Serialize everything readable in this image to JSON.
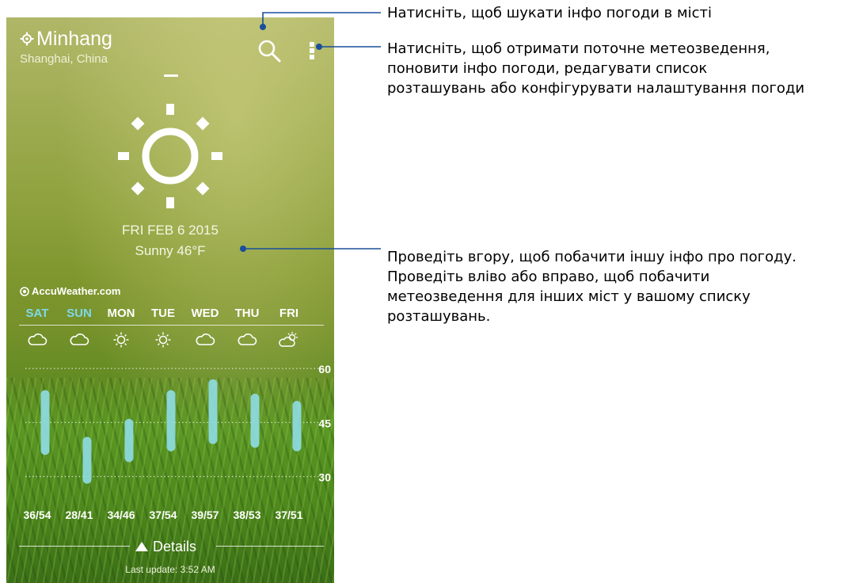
{
  "location": {
    "city": "Minhang",
    "region": "Shanghai, China",
    "icon": "location-pin-icon"
  },
  "toolbar": {
    "search_icon": "search-icon",
    "menu_icon": "more-vert-icon"
  },
  "current": {
    "icon": "sunny-icon",
    "date": "FRI FEB 6 2015",
    "condition": "Sunny 46°F"
  },
  "provider": {
    "name": "AccuWeather.com",
    "icon": "accuweather-logo-icon"
  },
  "forecast": {
    "days": [
      {
        "label": "SAT",
        "highlight": true,
        "icon": "cloudy-icon",
        "range": "36/54",
        "low": 36,
        "high": 54
      },
      {
        "label": "SUN",
        "highlight": true,
        "icon": "cloudy-icon",
        "range": "28/41",
        "low": 28,
        "high": 41
      },
      {
        "label": "MON",
        "highlight": false,
        "icon": "sunny-icon",
        "range": "34/46",
        "low": 34,
        "high": 46
      },
      {
        "label": "TUE",
        "highlight": false,
        "icon": "sunny-icon",
        "range": "37/54",
        "low": 37,
        "high": 54
      },
      {
        "label": "WED",
        "highlight": false,
        "icon": "cloudy-icon",
        "range": "39/57",
        "low": 39,
        "high": 57
      },
      {
        "label": "THU",
        "highlight": false,
        "icon": "cloudy-icon",
        "range": "38/53",
        "low": 38,
        "high": 53
      },
      {
        "label": "FRI",
        "highlight": false,
        "icon": "partly-cloudy-icon",
        "range": "37/51",
        "low": 37,
        "high": 51
      }
    ],
    "scale_labels": [
      "60",
      "45",
      "30"
    ]
  },
  "chart_data": {
    "type": "bar",
    "categories": [
      "SAT",
      "SUN",
      "MON",
      "TUE",
      "WED",
      "THU",
      "FRI"
    ],
    "series": [
      {
        "values": [
          36,
          28,
          34,
          37,
          39,
          38,
          37
        ]
      },
      {
        "values": [
          54,
          41,
          46,
          54,
          57,
          53,
          51
        ]
      }
    ],
    "yticks": [
      60,
      45,
      30
    ],
    "ylim": [
      20,
      64
    ],
    "grid": true,
    "bar_color": "#8edbe2"
  },
  "footer": {
    "details_label": "Details",
    "details_icon": "triangle-up-icon",
    "last_update": "Last update: 3:52 AM"
  },
  "callouts": {
    "search": "Натисніть, щоб шукати інфо погоди в місті",
    "menu": [
      "Натисніть, щоб отримати поточне метеозведення,",
      "поновити інфо погоди, редагувати список",
      "розташувань або конфігурувати налаштування погоди"
    ],
    "swipe": [
      "Проведіть вгору, щоб побачити іншу інфо про погоду.",
      "Проведіть вліво або вправо, щоб побачити",
      "метеозведення для інших міст у вашому списку",
      "розташувань."
    ],
    "line_color": "#1a4e9a"
  },
  "colors": {
    "highlight_day": "#7fd8e8",
    "text": "#ffffff"
  }
}
